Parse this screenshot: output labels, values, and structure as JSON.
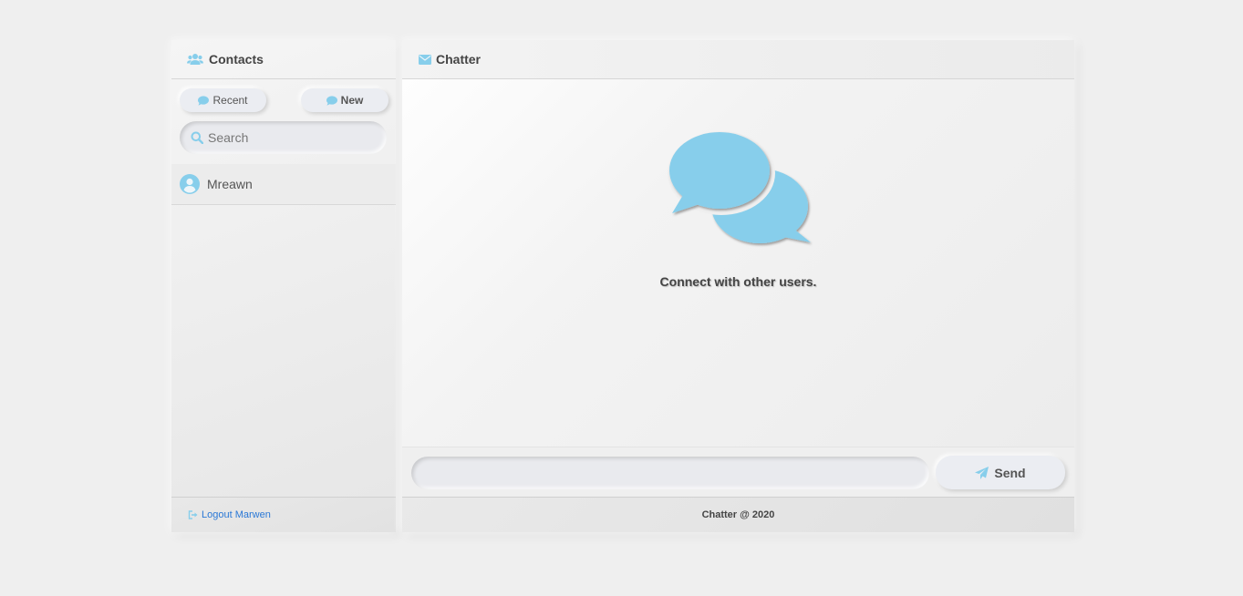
{
  "colors": {
    "accent": "#87ceeb",
    "link": "#2a78d6",
    "background": "#efefef"
  },
  "sidebar": {
    "title": "Contacts",
    "title_icon": "users-icon",
    "tabs": [
      {
        "label": "Recent",
        "icon": "comment-icon"
      },
      {
        "label": "New",
        "icon": "comment-icon"
      }
    ],
    "search": {
      "placeholder": "Search",
      "value": "",
      "icon": "search-icon"
    },
    "contacts": [
      {
        "name": "Mreawn",
        "icon": "user-circle-icon"
      }
    ],
    "footer": {
      "logout_label": "Logout Marwen",
      "icon": "sign-out-icon"
    }
  },
  "main": {
    "title": "Chatter",
    "title_icon": "envelope-icon",
    "welcome": {
      "icon": "comments-icon",
      "text": "Connect with other users."
    },
    "composer": {
      "placeholder": "",
      "value": "",
      "send_label": "Send",
      "send_icon": "paper-plane-icon"
    },
    "footer": "Chatter @ 2020"
  }
}
